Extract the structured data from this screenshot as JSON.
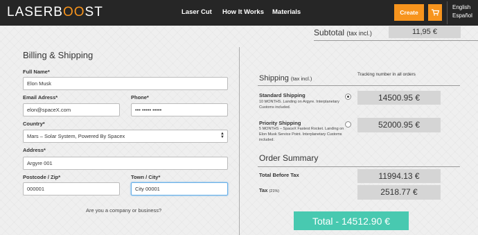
{
  "header": {
    "logo_part1": "LASERB",
    "logo_part2": "OO",
    "logo_part3": "ST",
    "nav": [
      {
        "label": "Laser Cut"
      },
      {
        "label": "How It Works"
      },
      {
        "label": "Materials"
      }
    ],
    "create_label": "Create",
    "cart_icon": "cart-icon",
    "languages": [
      "English",
      "Español"
    ],
    "colors": {
      "navbar": "#262626",
      "accent": "#f7941d"
    }
  },
  "subtotal": {
    "label": "Subtotal",
    "note": "(tax incl.)",
    "value": "11,95 €"
  },
  "billing": {
    "title": "Billing & Shipping",
    "full_name_label": "Full Name*",
    "full_name_value": "Elon Musk",
    "email_label": "Email Adress*",
    "email_value": "elon@spaceX.com",
    "phone_label": "Phone*",
    "phone_value": "••• ••••• •••••",
    "country_label": "Country*",
    "country_value": "Mars – Solar System, Powered By Spacex",
    "address_label": "Address*",
    "address_value": "Argyre 001",
    "postcode_label": "Postcode / Zip*",
    "postcode_value": "000001",
    "city_label": "Town / City*",
    "city_value": "City 00001",
    "company_link": "Are you a company or business?"
  },
  "shipping": {
    "title": "Shipping",
    "note": "(tax incl.)",
    "tracking": "Tracking number in all orders",
    "options": [
      {
        "name": "Standard Shipping",
        "desc": "10 MONTHS. Landing on Argyre. Interplanetary Customs included.",
        "price": "14500.95 €",
        "selected": true
      },
      {
        "name": "Priority Shipping",
        "desc": "5 MONTHS – SpaceX Fastest Rocket. Landing on Elon Musk Service Point. Interplanetary Customs included.",
        "price": "52000.95 €",
        "selected": false
      }
    ]
  },
  "summary": {
    "title": "Order Summary",
    "before_tax_label": "Total Before Tax",
    "before_tax_value": "11994.13 €",
    "tax_label": "Tax",
    "tax_rate": "(21%)",
    "tax_value": "2518.77 €",
    "total_label": "Total - 14512.90 €",
    "total_color": "#48c9b0"
  }
}
